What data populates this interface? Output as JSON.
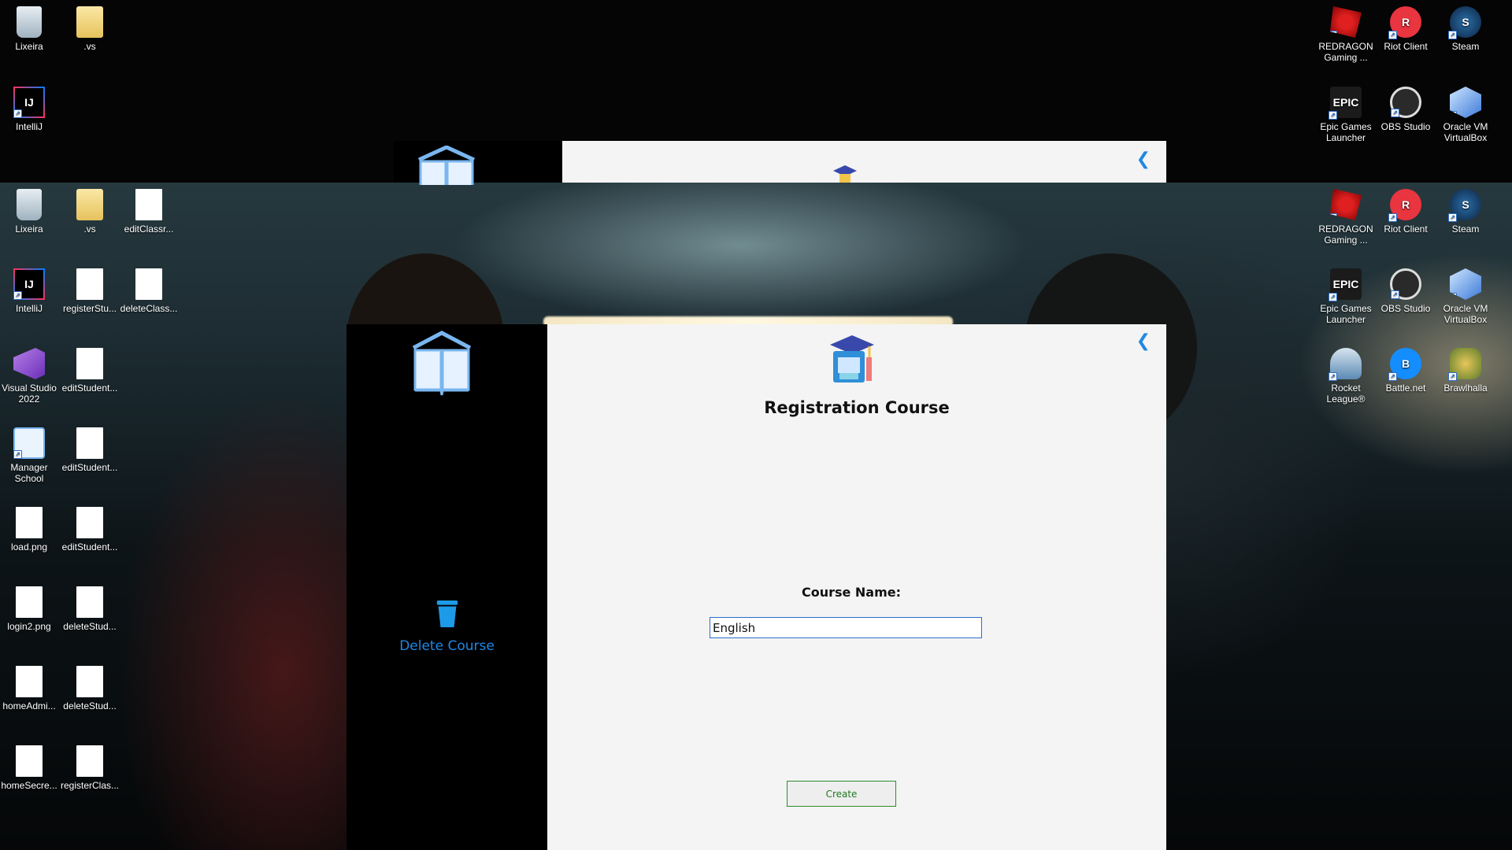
{
  "desktop": {
    "top_left_icons": [
      {
        "label": "Lixeira",
        "icon": "recycle-bin-icon"
      },
      {
        "label": ".vs",
        "icon": "folder-icon"
      },
      {
        "label": "IntelliJ",
        "icon": "intellij-icon"
      }
    ],
    "left_icons": [
      {
        "label": "Lixeira",
        "icon": "recycle-bin-icon"
      },
      {
        "label": ".vs",
        "icon": "folder-icon"
      },
      {
        "label": "editClassr...",
        "icon": "image-file-icon"
      },
      {
        "label": "IntelliJ",
        "icon": "intellij-icon"
      },
      {
        "label": "registerStu...",
        "icon": "image-file-icon"
      },
      {
        "label": "deleteClass...",
        "icon": "image-file-icon"
      },
      {
        "label": "Visual Studio 2022",
        "icon": "visual-studio-icon"
      },
      {
        "label": "editStudent...",
        "icon": "image-file-icon"
      },
      {
        "label": "Manager School",
        "icon": "manager-school-icon"
      },
      {
        "label": "editStudent...",
        "icon": "image-file-icon"
      },
      {
        "label": "load.png",
        "icon": "image-file-icon"
      },
      {
        "label": "editStudent...",
        "icon": "image-file-icon"
      },
      {
        "label": "login2.png",
        "icon": "image-file-icon"
      },
      {
        "label": "deleteStud...",
        "icon": "image-file-icon"
      },
      {
        "label": "homeAdmi...",
        "icon": "image-file-icon"
      },
      {
        "label": "deleteStud...",
        "icon": "image-file-icon"
      },
      {
        "label": "homeSecre...",
        "icon": "image-file-icon"
      },
      {
        "label": "registerClas...",
        "icon": "image-file-icon"
      }
    ],
    "top_right_icons": [
      {
        "label": "REDRAGON Gaming ...",
        "icon": "redragon-icon"
      },
      {
        "label": "Riot Client",
        "icon": "riot-client-icon"
      },
      {
        "label": "Steam",
        "icon": "steam-icon"
      },
      {
        "label": "Epic Games Launcher",
        "icon": "epic-games-icon"
      },
      {
        "label": "OBS Studio",
        "icon": "obs-studio-icon"
      },
      {
        "label": "Oracle VM VirtualBox",
        "icon": "virtualbox-icon"
      }
    ],
    "right_icons": [
      {
        "label": "REDRAGON Gaming ...",
        "icon": "redragon-icon"
      },
      {
        "label": "Riot Client",
        "icon": "riot-client-icon"
      },
      {
        "label": "Steam",
        "icon": "steam-icon"
      },
      {
        "label": "Epic Games Launcher",
        "icon": "epic-games-icon"
      },
      {
        "label": "OBS Studio",
        "icon": "obs-studio-icon"
      },
      {
        "label": "Oracle VM VirtualBox",
        "icon": "virtualbox-icon"
      },
      {
        "label": "Rocket League®",
        "icon": "rocket-league-icon"
      },
      {
        "label": "Battle.net",
        "icon": "battle-net-icon"
      },
      {
        "label": "Brawlhalla",
        "icon": "brawlhalla-icon"
      }
    ]
  },
  "app": {
    "sidebar": {
      "logo_icon": "open-book-icon",
      "delete_course_label": "Delete Course",
      "delete_icon": "trash-icon"
    },
    "form": {
      "back_icon": "chevron-left-icon",
      "header_icon": "graduation-book-icon",
      "title": "Registration Course",
      "course_name_label": "Course Name:",
      "course_name_value": "English",
      "create_button_label": "Create"
    }
  },
  "colors": {
    "accent": "#1e88e5",
    "create_border": "#2e8b2e",
    "panel_bg": "#f4f4f4",
    "sidebar_bg": "#000000"
  }
}
